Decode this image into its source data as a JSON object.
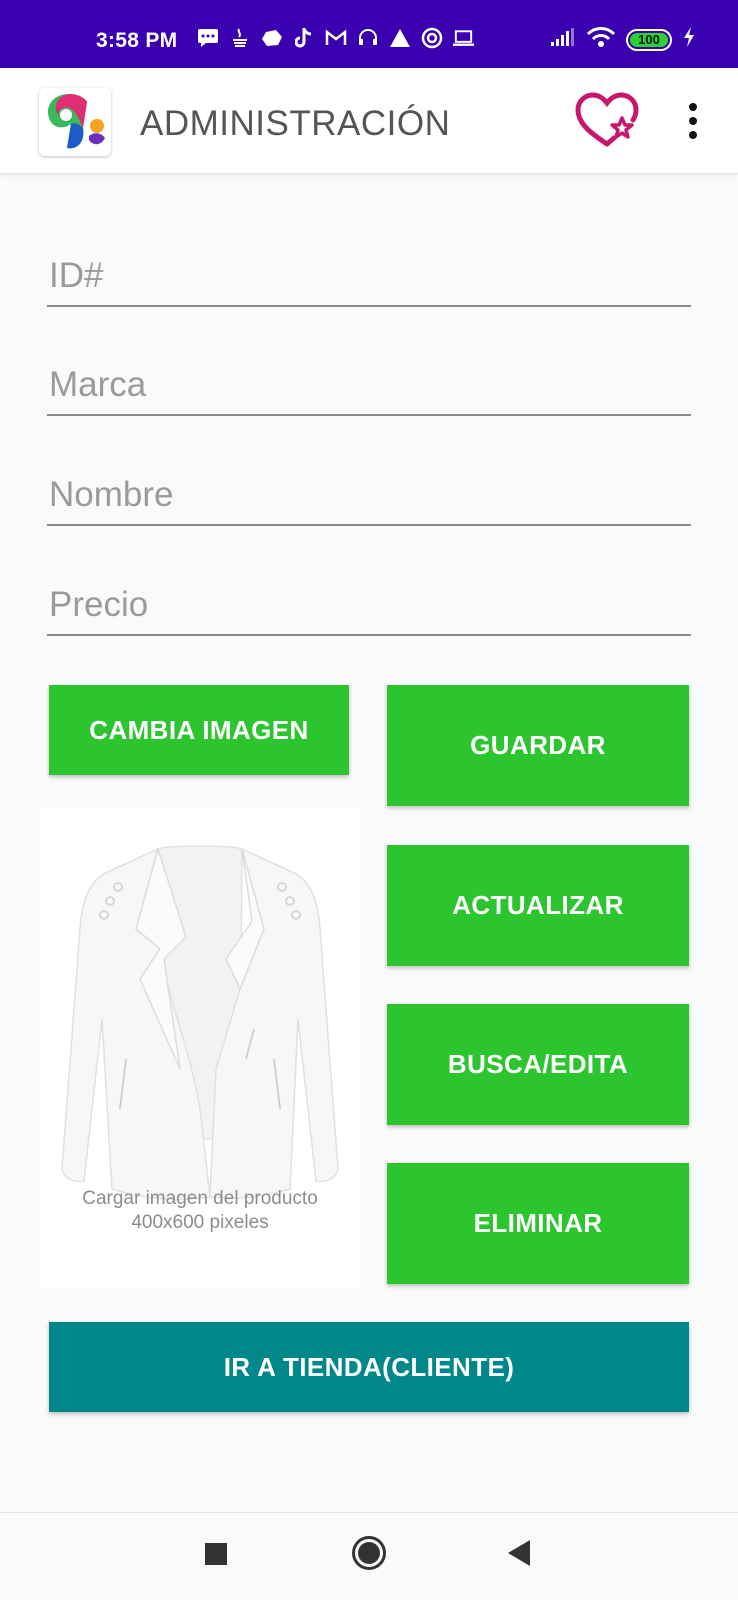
{
  "status_bar": {
    "time": "3:58 PM",
    "battery": "100",
    "notification_icons": [
      "message-icon",
      "java-icon",
      "cloud-icon",
      "tiktok-icon",
      "gmail-icon",
      "headset-icon",
      "app-icon",
      "target-icon",
      "laptop-icon"
    ]
  },
  "app_bar": {
    "title": "ADMINISTRACIÓN",
    "icons": [
      "app-logo-icon",
      "favorites-heart-icon",
      "more-vert-icon"
    ]
  },
  "form": {
    "id_placeholder": "ID#",
    "id_value": "",
    "brand_placeholder": "Marca",
    "brand_value": "",
    "name_placeholder": "Nombre",
    "name_value": "",
    "price_placeholder": "Precio",
    "price_value": ""
  },
  "buttons": {
    "change_image": "CAMBIA IMAGEN",
    "save": "GUARDAR",
    "update": "ACTUALIZAR",
    "search_edit": "BUSCA/EDITA",
    "delete": "ELIMINAR",
    "go_to_store": "IR A TIENDA(CLIENTE)"
  },
  "product_image": {
    "caption_line1": "Cargar imagen del producto",
    "caption_line2": "400x600 pixeles"
  },
  "colors": {
    "status_bar": "#3a00b0",
    "primary_button": "#2cc52f",
    "store_button": "#00878a",
    "heart_icon": "#c8186e"
  }
}
